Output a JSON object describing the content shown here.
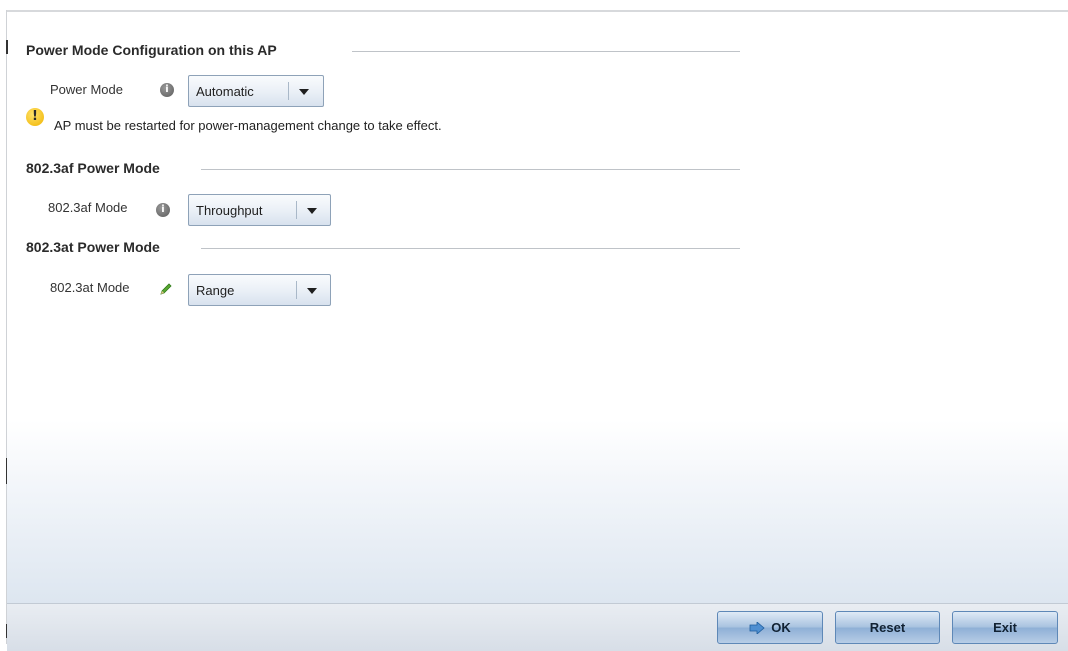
{
  "sections": {
    "power_mode": {
      "title": "Power Mode Configuration on this AP",
      "label": "Power Mode",
      "value": "Automatic",
      "warning": "AP must be restarted for power-management change to take effect."
    },
    "af": {
      "title": "802.3af Power Mode",
      "label": "802.3af Mode",
      "value": "Throughput"
    },
    "at": {
      "title": "802.3at Power Mode",
      "label": "802.3at Mode",
      "value": "Range"
    }
  },
  "icons": {
    "info": "i",
    "warning": "!",
    "edit": "pencil"
  },
  "buttons": {
    "ok": "OK",
    "reset": "Reset",
    "exit": "Exit"
  }
}
